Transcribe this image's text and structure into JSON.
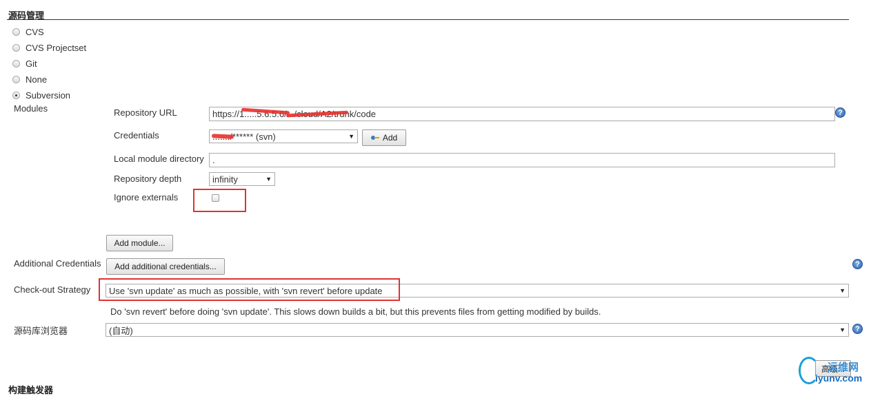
{
  "section": {
    "title": "源码管理"
  },
  "scm_options": [
    {
      "label": "CVS",
      "checked": false
    },
    {
      "label": "CVS Projectset",
      "checked": false
    },
    {
      "label": "Git",
      "checked": false
    },
    {
      "label": "None",
      "checked": false
    },
    {
      "label": "Subversion",
      "checked": true
    }
  ],
  "modules": {
    "label": "Modules",
    "repository_url": {
      "label": "Repository URL",
      "value": "https://1.....5.6.5.6/.../cloud/A2/trunk/code"
    },
    "credentials": {
      "label": "Credentials",
      "value": "......./****** (svn)",
      "add_label": "Add"
    },
    "local_module_directory": {
      "label": "Local module directory",
      "value": "."
    },
    "repository_depth": {
      "label": "Repository depth",
      "value": "infinity"
    },
    "ignore_externals": {
      "label": "Ignore externals",
      "checked": false
    },
    "add_module_label": "Add module..."
  },
  "additional_credentials": {
    "label": "Additional Credentials",
    "button_label": "Add additional credentials..."
  },
  "checkout_strategy": {
    "label": "Check-out Strategy",
    "value": "Use 'svn update' as much as possible, with 'svn revert' before update",
    "description": "Do 'svn revert' before doing 'svn update'. This slows down builds a bit, but this prevents files from getting modified by builds."
  },
  "repo_browser": {
    "label": "源码库浏览器",
    "value": "(自动)"
  },
  "advanced_button_label": "高级...",
  "next_section_title": "构建触发器",
  "help_icon_text": "?",
  "watermark": {
    "line1": "运维网",
    "line2": "iyunv.com"
  },
  "colors": {
    "highlight": "#e03131",
    "help_blue": "#2d66b3",
    "rule": "#333333"
  }
}
